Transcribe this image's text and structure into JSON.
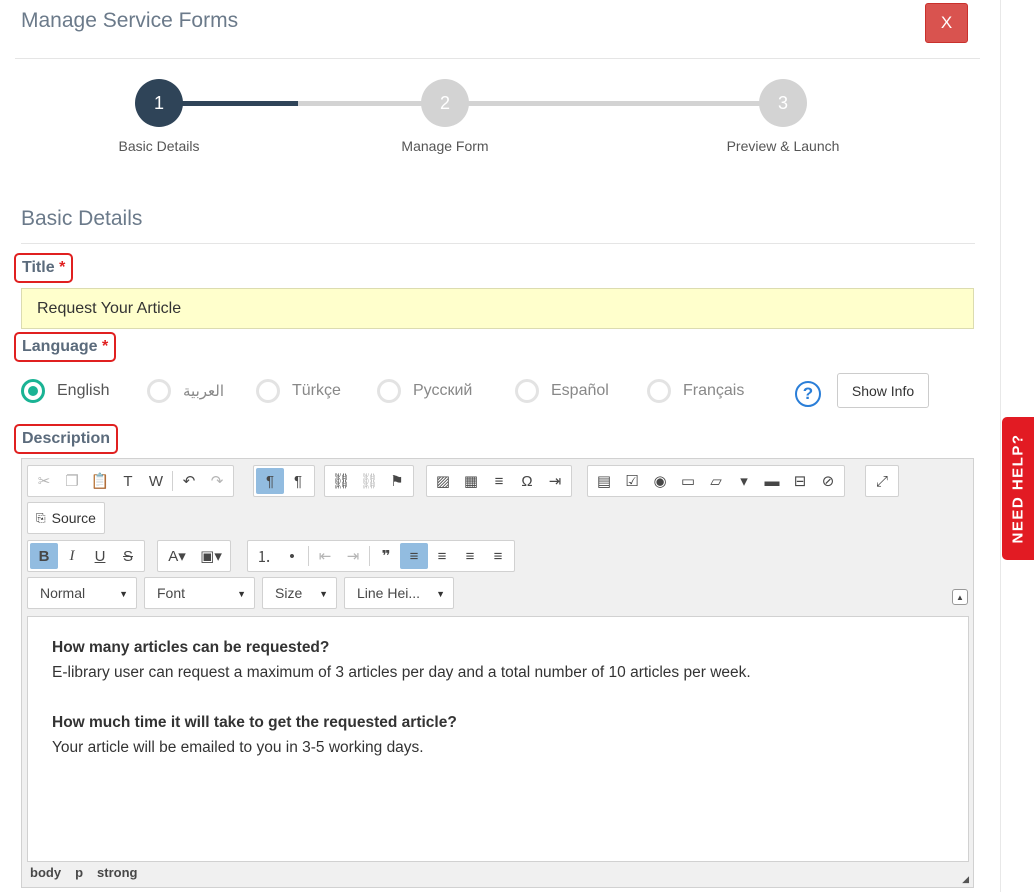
{
  "header": {
    "title": "Manage Service Forms",
    "close_label": "X"
  },
  "stepper": {
    "steps": [
      {
        "number": "1",
        "label": "Basic Details",
        "active": true
      },
      {
        "number": "2",
        "label": "Manage Form",
        "active": false
      },
      {
        "number": "3",
        "label": "Preview & Launch",
        "active": false
      }
    ]
  },
  "section": {
    "title": "Basic Details"
  },
  "title_field": {
    "label": "Title",
    "required_mark": "*",
    "value": "Request Your Article"
  },
  "language_field": {
    "label": "Language",
    "required_mark": "*",
    "options": [
      "English",
      "العربية",
      "Türkçe",
      "Русский",
      "Español",
      "Français"
    ],
    "selected": "English",
    "help_glyph": "?",
    "show_info_label": "Show Info"
  },
  "description_field": {
    "label": "Description",
    "toolbar": {
      "source_label": "Source",
      "format_combo": "Normal",
      "font_combo": "Font",
      "size_combo": "Size",
      "line_height_combo": "Line Hei..."
    },
    "content": [
      {
        "question": "How many articles can be requested?",
        "answer": "E-library user can request a maximum of 3 articles per day and a total number of 10 articles per week."
      },
      {
        "question": "How much time it will take to get the requested article?",
        "answer": "Your article will be emailed to you in 3-5 working days."
      }
    ],
    "path": [
      "body",
      "p",
      "strong"
    ]
  },
  "need_help": {
    "label": "NEED HELP?"
  },
  "colors": {
    "accent": "#1ab394",
    "step_active": "#2f4458",
    "close": "#d9534f",
    "required": "#e02020",
    "help_tab": "#e21b23",
    "title_input_bg": "#ffffcc"
  }
}
